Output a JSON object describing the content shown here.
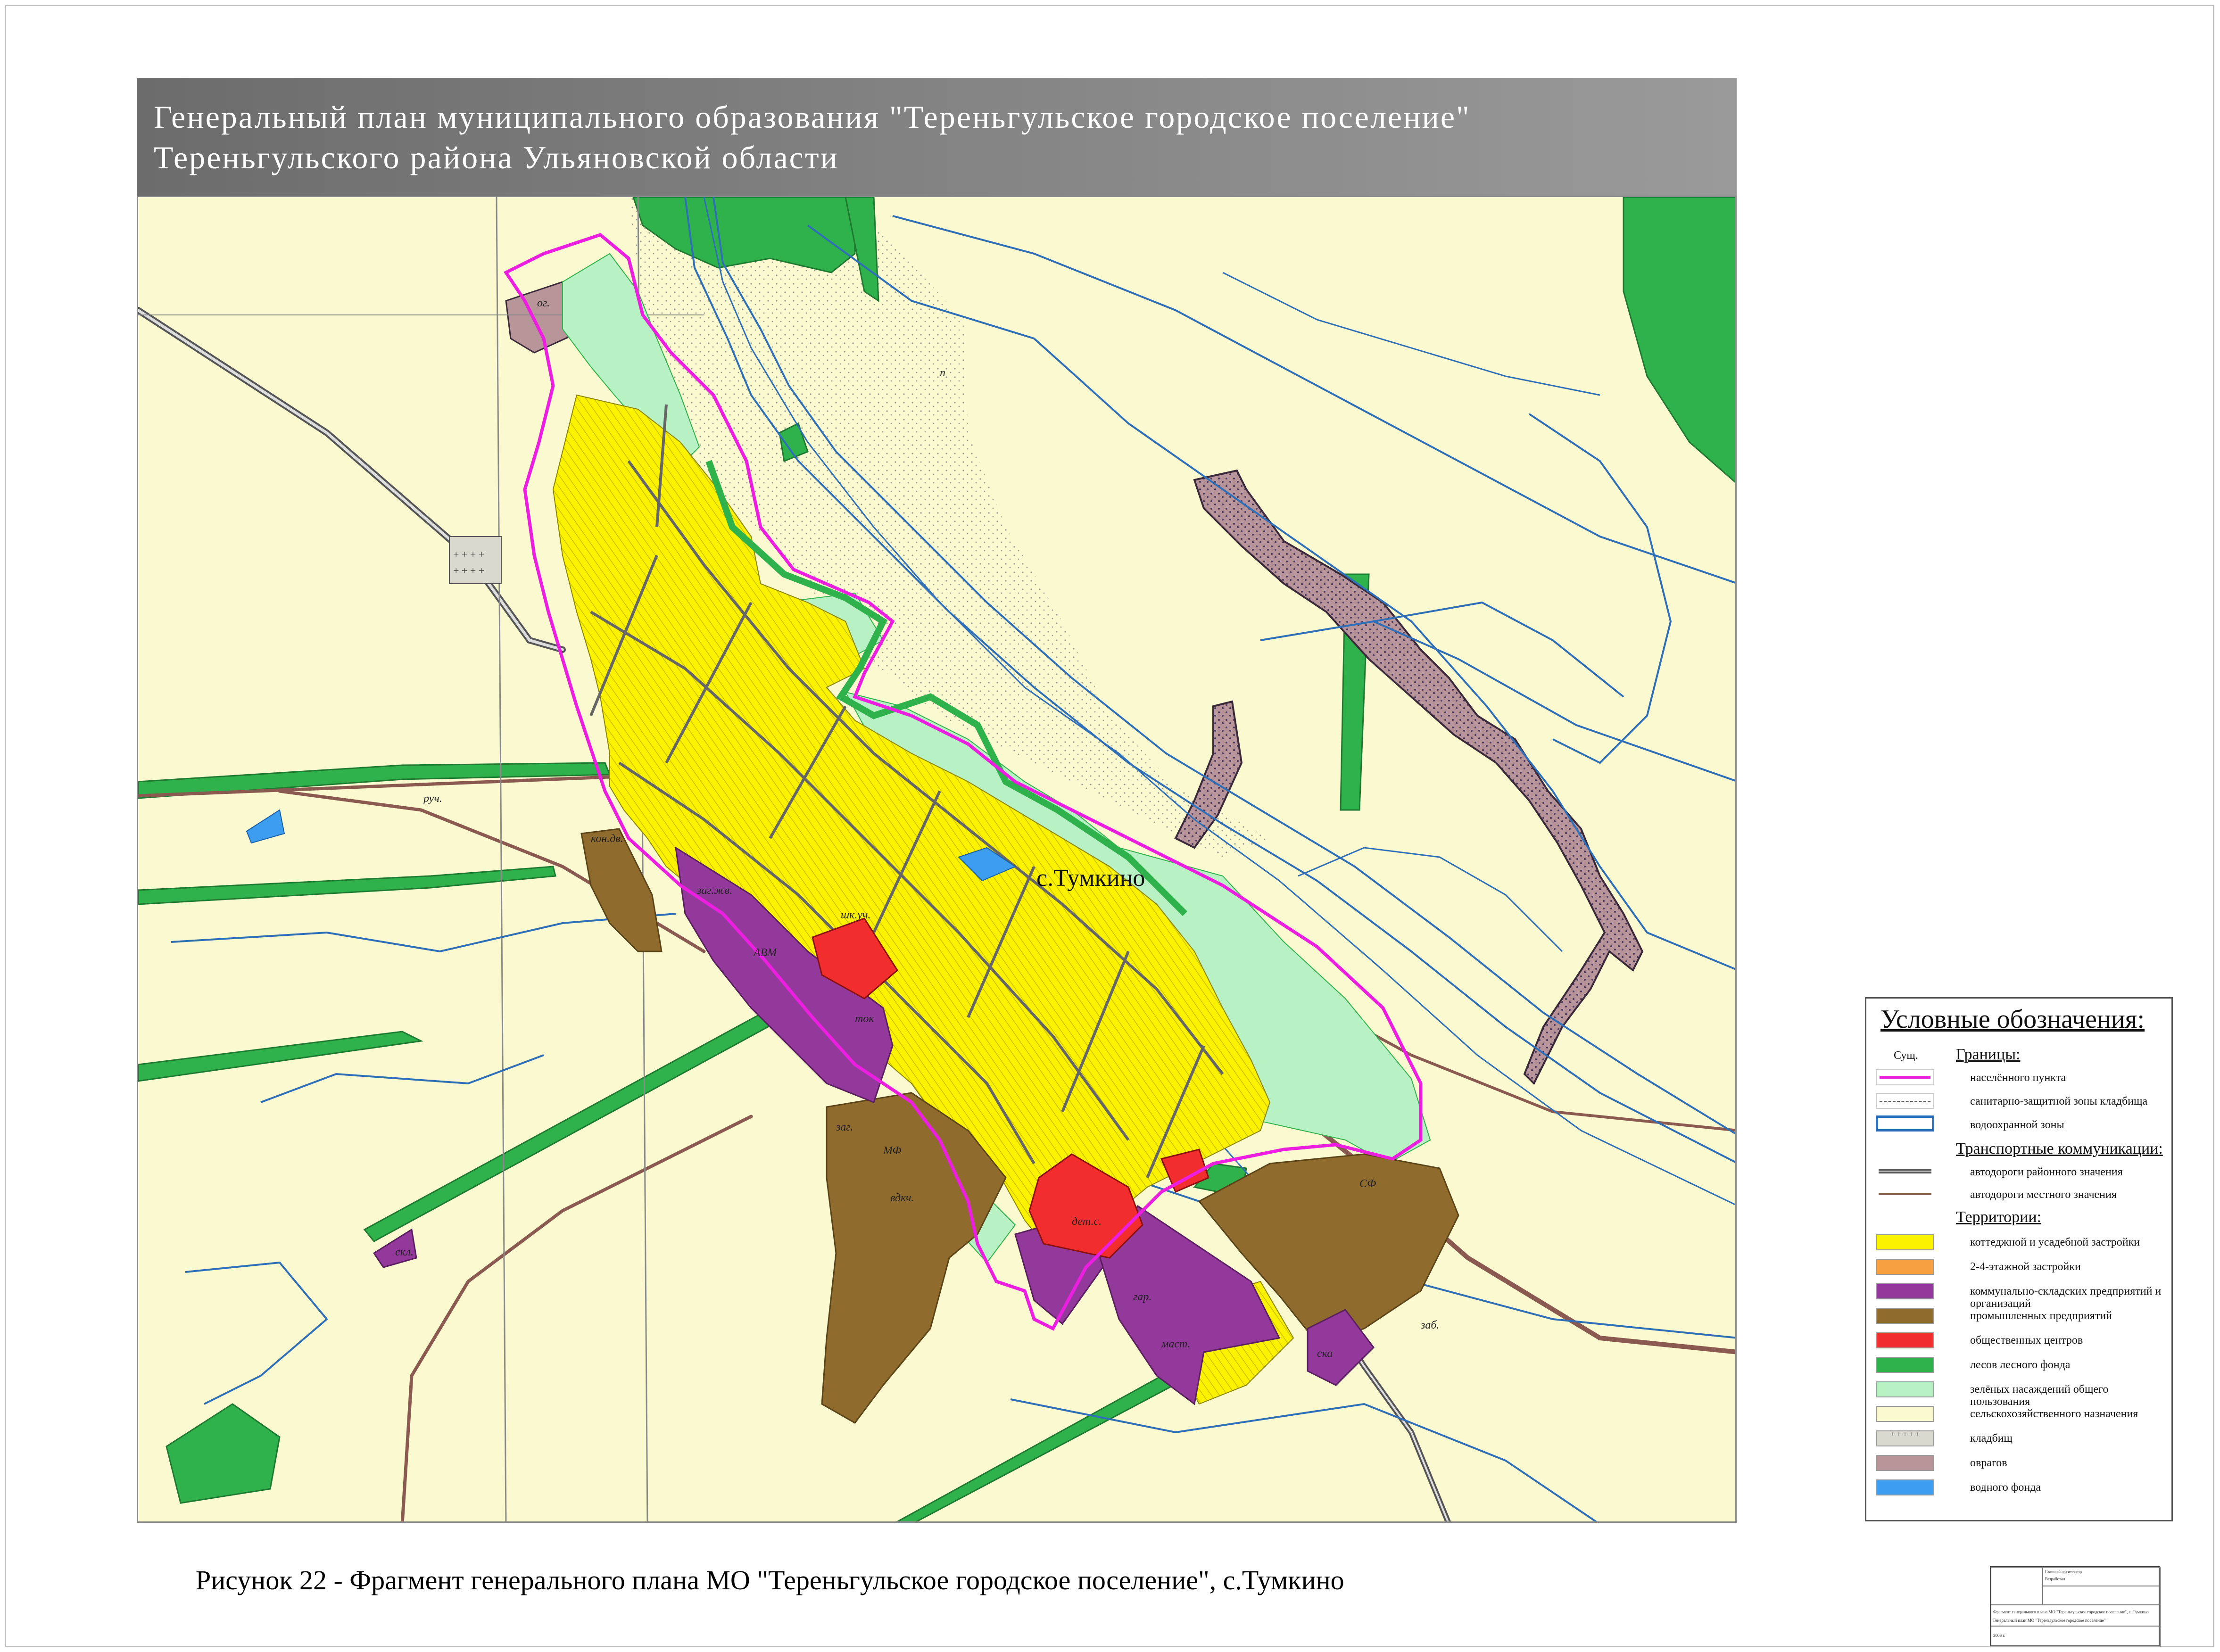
{
  "title": {
    "line1": "Генеральный план муниципального образования \"Тереньгульское городское поселение\"",
    "line2": "Тереньгульского района Ульяновской области"
  },
  "map": {
    "settlement_label": "с.Тумкино",
    "abbreviations": {
      "og": "ог.",
      "ruch": "руч.",
      "kon_dv": "кон.дв.",
      "zag_zh": "заг.жв.",
      "avm": "АВМ",
      "shk_uch": "шк.уч.",
      "tok": "ток",
      "mf": "МФ",
      "zag": "заг.",
      "vdkch": "вдкч.",
      "det_s": "дет.с.",
      "gar": "гар.",
      "mast": "маст.",
      "ska": "ска",
      "sf": "СФ",
      "skl": "скл.",
      "zab": "заб.",
      "p": "п"
    },
    "colors": {
      "agriculture": "#fbf9d0",
      "residential": "#fbf200",
      "communal": "#93399b",
      "industrial": "#8f6b2e",
      "public": "#f22d2d",
      "forest": "#2fb24b",
      "green_public": "#b8f2c4",
      "ravine": "#b89599",
      "water": "#3d9ef0",
      "boundary": "#ec1fe0",
      "river": "#2f6fb8"
    }
  },
  "legend": {
    "title": "Условные обозначения:",
    "sush": "Сущ.",
    "headings": {
      "boundaries": "Границы:",
      "transport": "Транспортные коммуникации:",
      "territories": "Территории:"
    },
    "boundaries": [
      {
        "label": "населённого пункта"
      },
      {
        "label": "санитарно-защитной зоны кладбища"
      },
      {
        "label": "водоохранной зоны"
      }
    ],
    "transport": [
      {
        "label": "автодороги районного значения"
      },
      {
        "label": "автодороги местного значения"
      }
    ],
    "territories": [
      {
        "label": "коттеджной и усадебной застройки",
        "color": "#fbf200"
      },
      {
        "label": "2-4-этажной застройки",
        "color": "#f7a040"
      },
      {
        "label": "коммунально-складских предприятий и организаций",
        "color": "#93399b"
      },
      {
        "label": "промышленных предприятий",
        "color": "#8f6b2e"
      },
      {
        "label": "общественных центров",
        "color": "#f22d2d"
      },
      {
        "label": "лесов лесного фонда",
        "color": "#2fb24b"
      },
      {
        "label": "зелёных насаждений общего пользования",
        "color": "#b8f2c4"
      },
      {
        "label": "сельскохозяйственного назначения",
        "color": "#fbf9d0"
      },
      {
        "label": "кладбищ",
        "color": "#d9d9cf",
        "glyphs": "+ + + + +"
      },
      {
        "label": "оврагов",
        "color": "#b89599"
      },
      {
        "label": "водного фонда",
        "color": "#3d9ef0"
      }
    ]
  },
  "caption": "Рисунок 22 - Фрагмент генерального плана МО \"Тереньгульское городское поселение\", с.Тумкино",
  "stamp": {
    "row1": "Главный архитектор",
    "row2": "Разработал",
    "note1": "Фрагмент генерального плана МО \"Тереньгульское городское поселение\", с. Тумкино",
    "note2": "Генеральный план МО \"Тереньгульское городское поселение\"",
    "year": "2006 г."
  }
}
